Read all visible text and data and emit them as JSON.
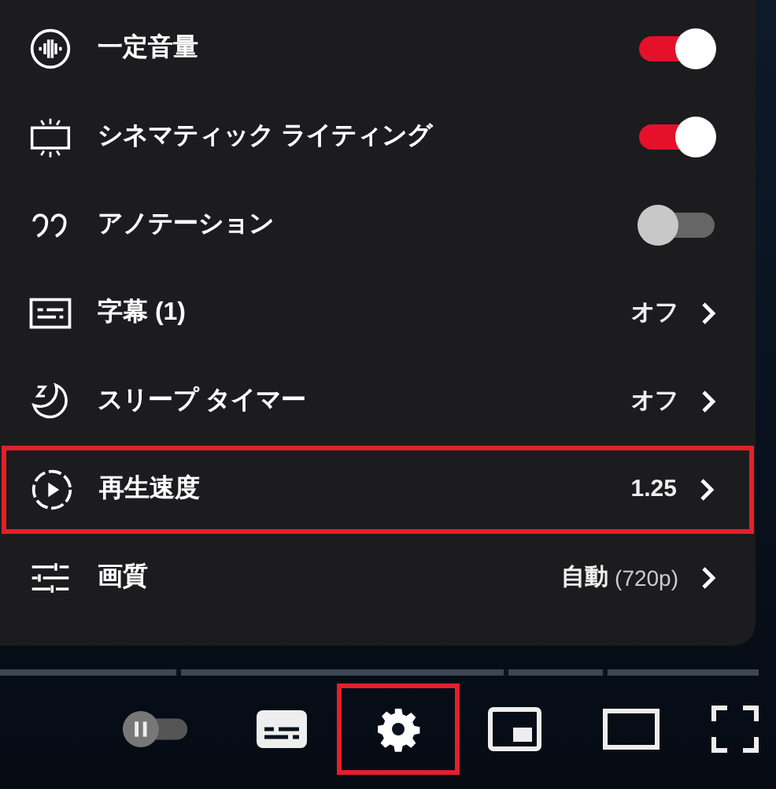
{
  "settings_menu": {
    "items": [
      {
        "kind": "toggle",
        "label": "一定音量",
        "on": true,
        "highlighted": false
      },
      {
        "kind": "toggle",
        "label": "シネマティック ライティング",
        "on": true,
        "highlighted": false
      },
      {
        "kind": "toggle",
        "label": "アノテーション",
        "on": false,
        "highlighted": false
      },
      {
        "kind": "submenu",
        "label": "字幕 (1)",
        "value": "オフ",
        "highlighted": false
      },
      {
        "kind": "submenu",
        "label": "スリープ タイマー",
        "value": "オフ",
        "highlighted": false
      },
      {
        "kind": "submenu",
        "label": "再生速度",
        "value": "1.25",
        "highlighted": true
      },
      {
        "kind": "submenu",
        "label": "画質",
        "value": "自動",
        "value_detail": "(720p)",
        "highlighted": false
      }
    ]
  },
  "controls": [
    {
      "kind": "autoplay",
      "on": false,
      "highlighted": false
    },
    {
      "kind": "subtitles",
      "highlighted": false
    },
    {
      "kind": "settings",
      "highlighted": true
    },
    {
      "kind": "miniplayer",
      "highlighted": false
    },
    {
      "kind": "theater",
      "highlighted": false
    },
    {
      "kind": "fullscreen",
      "highlighted": false
    }
  ]
}
